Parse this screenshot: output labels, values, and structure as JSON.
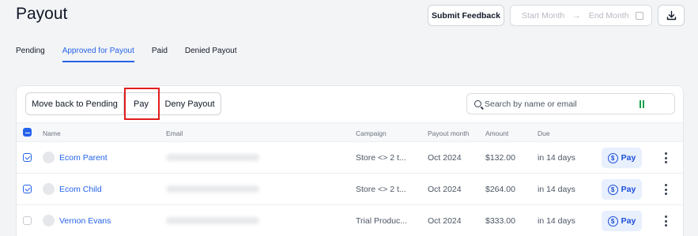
{
  "header": {
    "title": "Payout",
    "submit_feedback_label": "Submit Feedback",
    "start_month_placeholder": "Start Month",
    "arrow": "→",
    "end_month_placeholder": "End Month"
  },
  "tabs": [
    {
      "label": "Pending",
      "active": false
    },
    {
      "label": "Approved for Payout",
      "active": true
    },
    {
      "label": "Paid",
      "active": false
    },
    {
      "label": "Denied Payout",
      "active": false
    }
  ],
  "actions": {
    "move_back_label": "Move back to Pending",
    "pay_label": "Pay",
    "deny_label": "Deny Payout"
  },
  "search": {
    "placeholder": "Search by name or email"
  },
  "table": {
    "columns": {
      "name": "Name",
      "email": "Email",
      "campaign": "Campaign",
      "payout_month": "Payout month",
      "amount": "Amount",
      "due": "Due"
    },
    "rows": [
      {
        "name": "Ecom Parent",
        "campaign": "Store <> 2 t...",
        "payout_month": "Oct 2024",
        "amount": "$132.00",
        "due": "in 14 days",
        "pay_label": "Pay",
        "checked": true
      },
      {
        "name": "Ecom Child",
        "campaign": "Store <> 2 t...",
        "payout_month": "Oct 2024",
        "amount": "$264.00",
        "due": "in 14 days",
        "pay_label": "Pay",
        "checked": true
      },
      {
        "name": "Vernon Evans",
        "campaign": "Trial Produc...",
        "payout_month": "Oct 2024",
        "amount": "$333.00",
        "due": "in 14 days",
        "pay_label": "Pay",
        "checked": false
      }
    ]
  },
  "colors": {
    "accent": "#2563eb",
    "highlight": "#e11d1d",
    "pay_bg": "#e8f0fe"
  },
  "icons": [
    "download-icon",
    "calendar-icon",
    "search-icon",
    "dollar-icon",
    "kebab-menu-icon",
    "ai-sparkle-icon"
  ]
}
